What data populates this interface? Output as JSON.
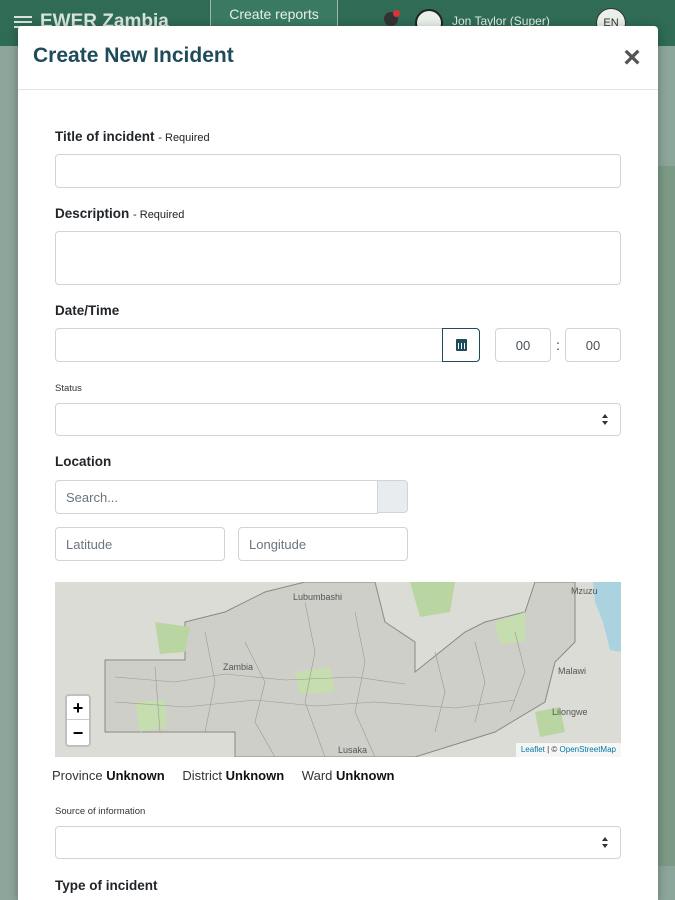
{
  "app": {
    "title": "EWER Zambia",
    "create_reports_label": "Create reports",
    "user_name": "Jon Taylor (Super)",
    "language": "EN"
  },
  "modal": {
    "title": "Create New Incident",
    "close_label": "×"
  },
  "form": {
    "title_label": "Title of incident",
    "title_required": "- Required",
    "title_value": "",
    "description_label": "Description",
    "description_required": "- Required",
    "description_value": "",
    "datetime_label": "Date/Time",
    "date_value": "",
    "hour_value": "00",
    "minute_value": "00",
    "time_separator": ":",
    "status_label": "Status",
    "status_value": "",
    "location_label": "Location",
    "search_placeholder": "Search...",
    "latitude_placeholder": "Latitude",
    "longitude_placeholder": "Longitude",
    "source_label": "Source of information",
    "source_value": "",
    "type_label": "Type of incident"
  },
  "map": {
    "labels": [
      "Lubumbashi",
      "Zambia",
      "Malawi",
      "Lilongwe",
      "Lusaka",
      "Mzuzu"
    ],
    "zoom_in": "+",
    "zoom_out": "−",
    "attribution_leaflet": "Leaflet",
    "attribution_sep": " | © ",
    "attribution_osm": "OpenStreetMap"
  },
  "location_info": {
    "province_label": "Province",
    "province_value": "Unknown",
    "district_label": "District",
    "district_value": "Unknown",
    "ward_label": "Ward",
    "ward_value": "Unknown"
  },
  "colors": {
    "primary": "#1f4c5b",
    "topbar": "#2f6b55"
  }
}
